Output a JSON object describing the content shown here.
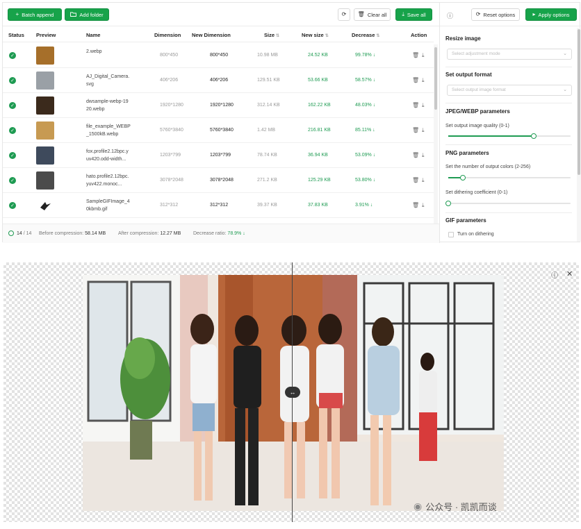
{
  "toolbar": {
    "batch_append": "Batch append",
    "add_folder": "Add folder",
    "clear_all": "Clear all",
    "save_all": "Save all"
  },
  "table": {
    "columns": [
      "Status",
      "Preview",
      "Name",
      "Dimension",
      "New Dimension",
      "Size",
      "New size",
      "Decrease",
      "Action"
    ],
    "rows": [
      {
        "name": "2.webp",
        "dimension": "800*450",
        "new_dimension": "800*450",
        "size": "10.98 MB",
        "new_size": "24.52 KB",
        "decrease": "99.78%",
        "thumb_color": "#a66f2a"
      },
      {
        "name": "AJ_Digital_Camera.svg",
        "dimension": "406*206",
        "new_dimension": "406*206",
        "size": "129.51 KB",
        "new_size": "53.66 KB",
        "decrease": "58.57%",
        "thumb_color": "#9aa0a6"
      },
      {
        "name": "dwsample-webp-1920.webp",
        "dimension": "1920*1280",
        "new_dimension": "1920*1280",
        "size": "312.14 KB",
        "new_size": "162.22 KB",
        "decrease": "48.03%",
        "thumb_color": "#3b2a1c"
      },
      {
        "name": "file_example_WEBP_1500kB.webp",
        "dimension": "5760*3840",
        "new_dimension": "5760*3840",
        "size": "1.42 MB",
        "new_size": "216.81 KB",
        "decrease": "85.11%",
        "thumb_color": "#c79a52"
      },
      {
        "name": "fox.profile2.12bpc.yuv420.odd-width...",
        "dimension": "1203*799",
        "new_dimension": "1203*799",
        "size": "78.74 KB",
        "new_size": "36.94 KB",
        "decrease": "53.09%",
        "thumb_color": "#3e4a5c"
      },
      {
        "name": "hato.profile2.12bpc.yuv422.monoc...",
        "dimension": "3078*2048",
        "new_dimension": "3078*2048",
        "size": "271.2 KB",
        "new_size": "125.29 KB",
        "decrease": "53.80%",
        "thumb_color": "#4b4b4b"
      },
      {
        "name": "SampleGIFImage_40kbmb.gif",
        "dimension": "312*312",
        "new_dimension": "312*312",
        "size": "39.37 KB",
        "new_size": "37.83 KB",
        "decrease": "3.91%",
        "thumb_color": "#ffffff"
      }
    ]
  },
  "footer": {
    "count": "14",
    "total": "14",
    "before_label": "Before compression:",
    "before_value": "58.14 MB",
    "after_label": "After compression:",
    "after_value": "12.27 MB",
    "ratio_label": "Decrease ratio:",
    "ratio_value": "78.9%"
  },
  "panel": {
    "reset_options": "Reset options",
    "apply_options": "Apply options",
    "resize_title": "Resize image",
    "resize_placeholder": "Select adjustment mode",
    "format_title": "Set output format",
    "format_placeholder": "Select output image format",
    "jpeg_title": "JPEG/WEBP parameters",
    "quality_label": "Set output image quality (0-1)",
    "quality_value": 0.7,
    "png_title": "PNG parameters",
    "colors_label": "Set the number of output colors (2-256)",
    "colors_value": 0.12,
    "dither_label": "Set dithering coefficient (0-1)",
    "dither_value": 0,
    "gif_title": "GIF parameters",
    "turn_on_dithering": "Turn on dithering"
  },
  "viewer": {
    "watermark": "公众号 · 凯凯而谈"
  },
  "colors": {
    "accent": "#17a34a",
    "accent_text": "#1e9b52"
  }
}
